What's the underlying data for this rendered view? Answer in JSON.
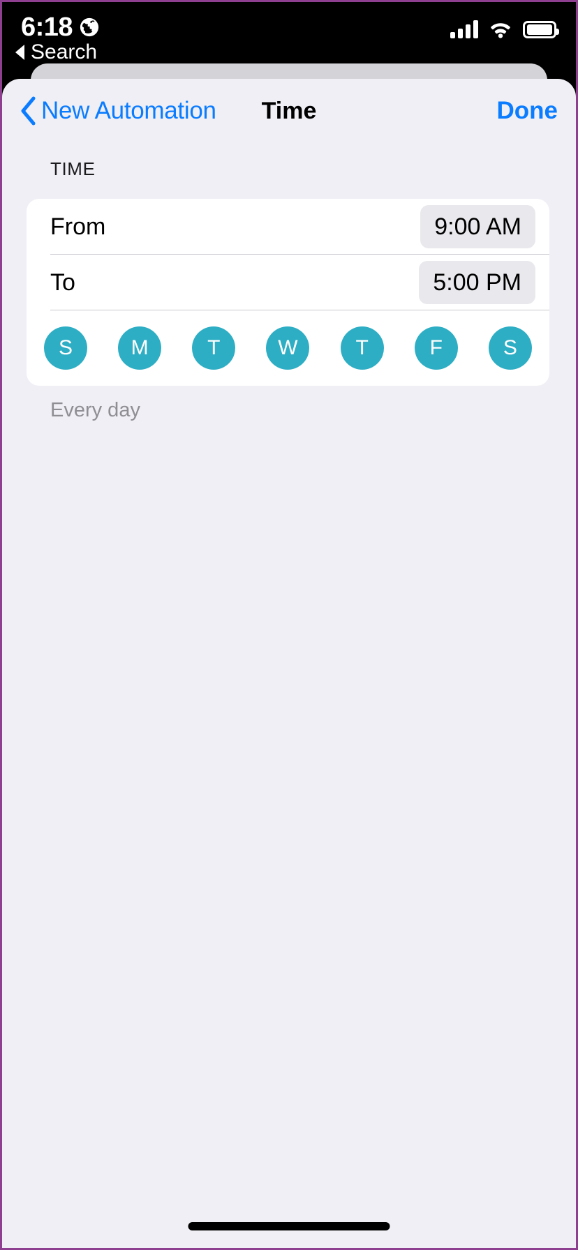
{
  "status_bar": {
    "time": "6:18",
    "location_icon": "globe-icon",
    "back_to_app_label": "Search",
    "back_triangle_icon": "left-triangle-icon",
    "cellular_icon": "cellular-signal-icon",
    "wifi_icon": "wifi-icon",
    "battery_icon": "battery-full-icon"
  },
  "nav_bar": {
    "back_label": "New Automation",
    "back_chevron_icon": "chevron-left-icon",
    "title": "Time",
    "done_label": "Done"
  },
  "section": {
    "header": "TIME",
    "rows": [
      {
        "label": "From",
        "value": "9:00 AM"
      },
      {
        "label": "To",
        "value": "5:00 PM"
      }
    ],
    "days": [
      {
        "letter": "S",
        "name": "Sunday",
        "selected": true
      },
      {
        "letter": "M",
        "name": "Monday",
        "selected": true
      },
      {
        "letter": "T",
        "name": "Tuesday",
        "selected": true
      },
      {
        "letter": "W",
        "name": "Wednesday",
        "selected": true
      },
      {
        "letter": "T",
        "name": "Thursday",
        "selected": true
      },
      {
        "letter": "F",
        "name": "Friday",
        "selected": true
      },
      {
        "letter": "S",
        "name": "Saturday",
        "selected": true
      }
    ],
    "repeat_summary": "Every day"
  },
  "colors": {
    "accent_blue": "#0a7cff",
    "day_selected": "#2eaec4",
    "sheet_background": "#f0eff5",
    "card_background": "#ffffff",
    "value_pill": "#e9e9ed",
    "muted_text": "#8e8e93"
  },
  "home_indicator": "home-indicator"
}
